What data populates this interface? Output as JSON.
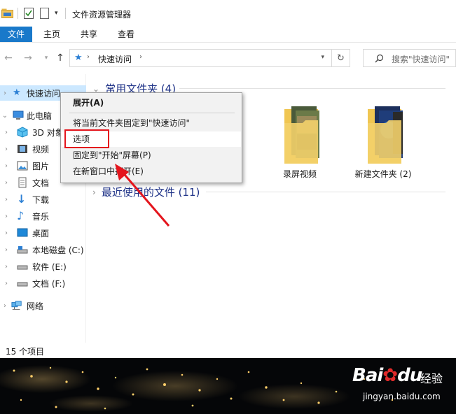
{
  "window": {
    "title": "文件资源管理器"
  },
  "ribbon": {
    "tabs": [
      "文件",
      "主页",
      "共享",
      "查看"
    ]
  },
  "address": {
    "crumb": "快速访问",
    "search_placeholder": "搜索\"快速访问\""
  },
  "nav": {
    "quick_access": "快速访问",
    "this_pc": "此电脑",
    "items": [
      {
        "label": "3D 对象",
        "icon": "3d-objects-icon"
      },
      {
        "label": "视频",
        "icon": "video-folder-icon"
      },
      {
        "label": "图片",
        "icon": "pictures-folder-icon"
      },
      {
        "label": "文档",
        "icon": "documents-folder-icon"
      },
      {
        "label": "下载",
        "icon": "download-icon"
      },
      {
        "label": "音乐",
        "icon": "music-icon"
      },
      {
        "label": "桌面",
        "icon": "desktop-icon"
      },
      {
        "label": "本地磁盘 (C:)",
        "icon": "drive-icon"
      },
      {
        "label": "软件 (E:)",
        "icon": "drive-icon"
      },
      {
        "label": "文档 (F:)",
        "icon": "drive-icon"
      }
    ],
    "network": "网络"
  },
  "content": {
    "group_frequent": "常用文件夹 (4)",
    "group_recent": "最近使用的文件 (11)",
    "folders": [
      {
        "label": "录屏视频"
      },
      {
        "label": "新建文件夹 (2)"
      }
    ]
  },
  "context_menu": {
    "items": [
      "展开(A)",
      "将当前文件夹固定到\"快速访问\"",
      "选项",
      "固定到\"开始\"屏幕(P)",
      "在新窗口中打开(E)"
    ]
  },
  "status": {
    "count": "15 个项目"
  },
  "watermark": {
    "brand": "Bai",
    "brand2": "du",
    "jingyan": "经验",
    "url": "jingyan.baidu.com"
  },
  "colors": {
    "accent": "#1979ca",
    "highlight_box": "#e4151d",
    "arrow": "#e4151d",
    "selection": "#cce8ff",
    "group_header": "#1e3287"
  }
}
